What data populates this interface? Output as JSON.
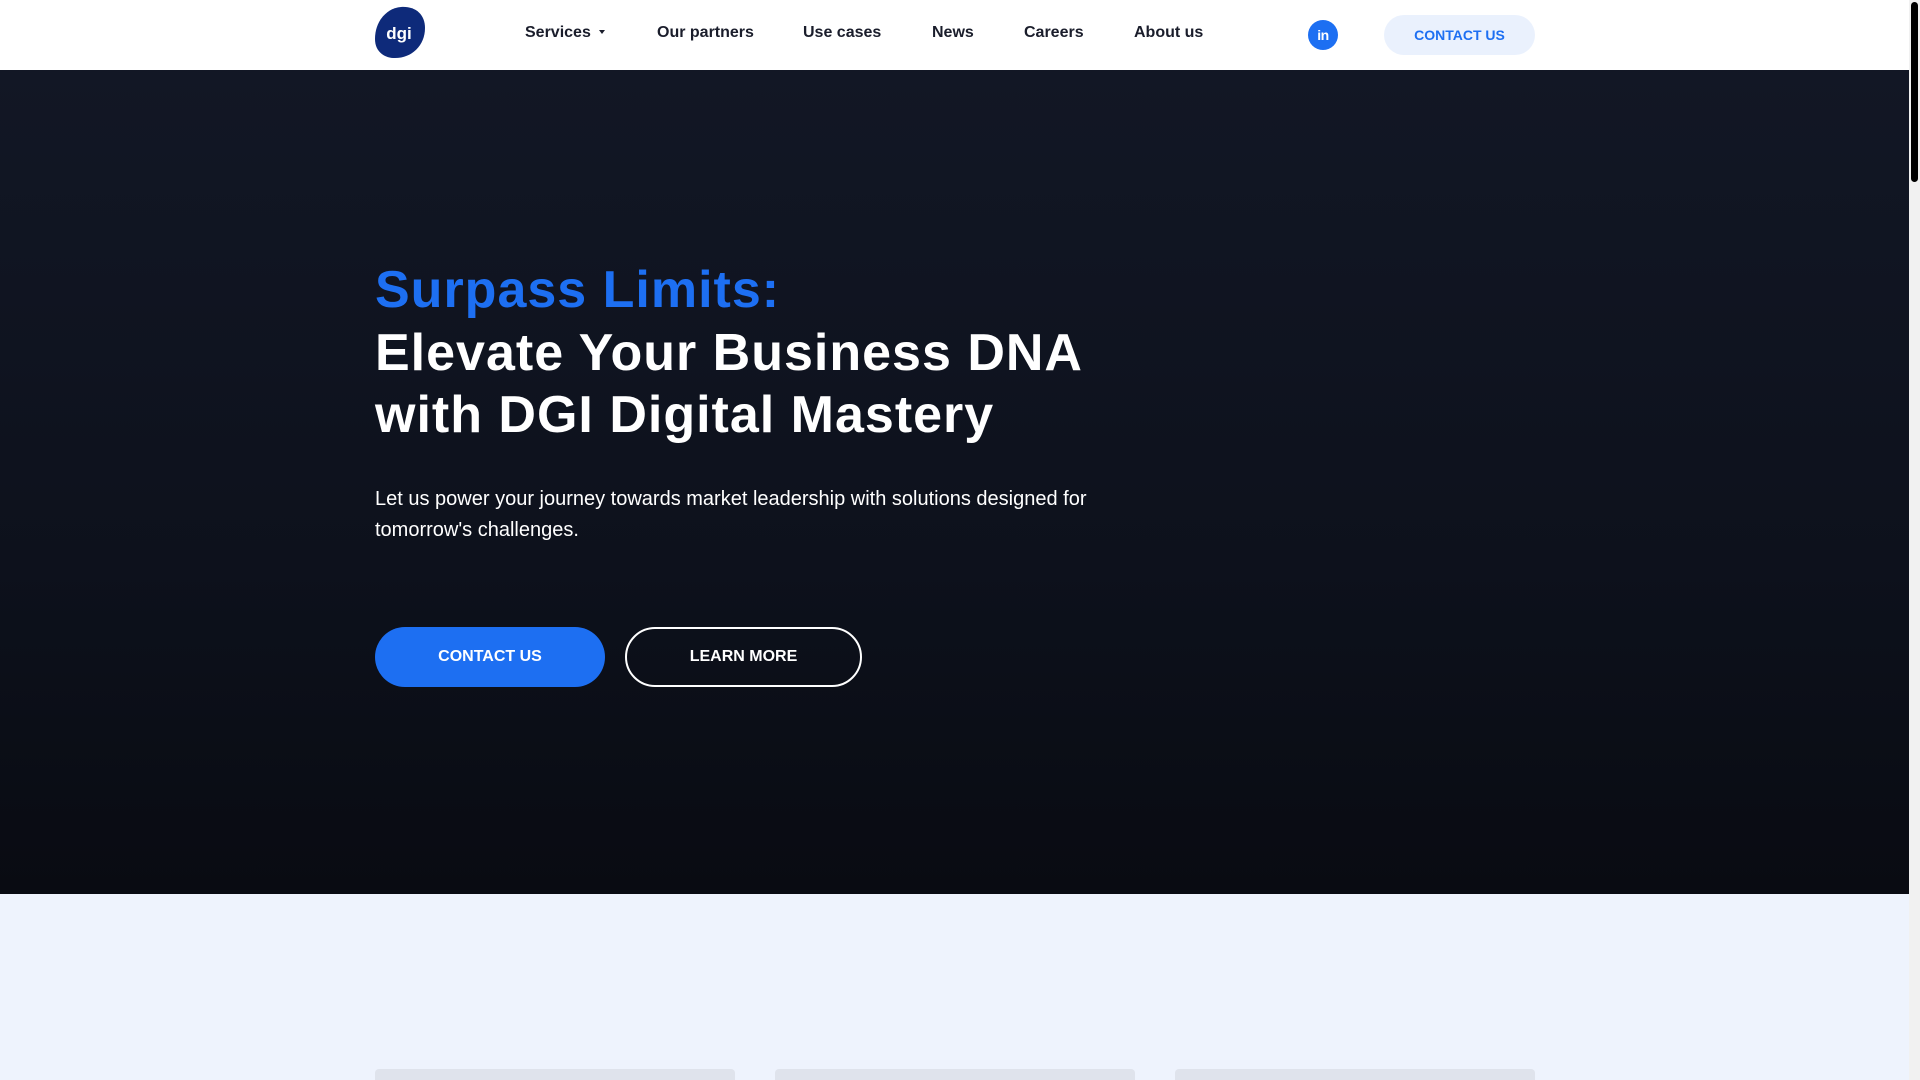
{
  "header": {
    "logo_text": "dgi",
    "nav": [
      {
        "label": "Services",
        "has_dropdown": true
      },
      {
        "label": "Our partners"
      },
      {
        "label": "Use cases"
      },
      {
        "label": "News"
      },
      {
        "label": "Careers"
      },
      {
        "label": "About us"
      }
    ],
    "linkedin_label": "in",
    "cta_label": "CONTACT US"
  },
  "hero": {
    "accent": "Surpass Limits:",
    "title": "Elevate Your Business DNA with DGI Digital Mastery",
    "subtitle": "Let us power your journey towards market leadership with solutions designed for tomorrow's challenges.",
    "primary_button": "CONTACT US",
    "secondary_button": "LEARN MORE"
  },
  "colors": {
    "accent": "#1d6ff2",
    "hero_bg": "#121725",
    "logo_bg": "#0e2a7a",
    "section_bg": "#eef3fd"
  },
  "icons": {
    "logo": "dgi-logo",
    "linkedin": "linkedin-icon",
    "dropdown": "chevron-down-icon"
  }
}
